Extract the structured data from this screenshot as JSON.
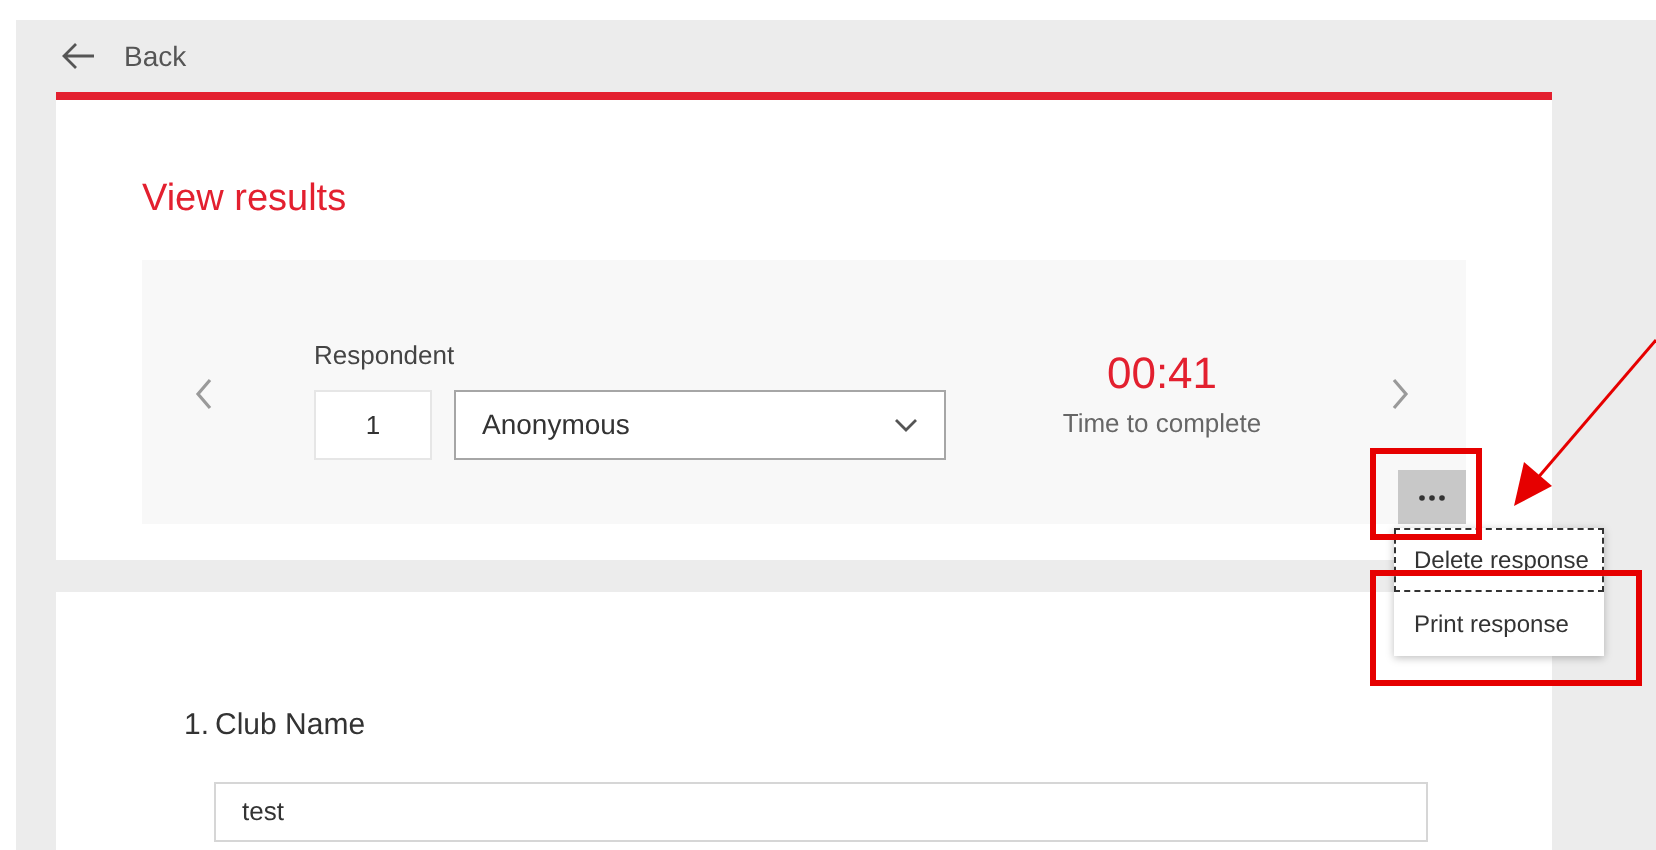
{
  "back": {
    "label": "Back"
  },
  "title": "View results",
  "respondent": {
    "label": "Respondent",
    "number": "1",
    "name": "Anonymous"
  },
  "timer": {
    "value": "00:41",
    "label": "Time to complete"
  },
  "menu": {
    "items": [
      {
        "label": "Delete response",
        "focused": true
      },
      {
        "label": "Print response",
        "focused": false
      }
    ]
  },
  "questions": [
    {
      "number": "1.",
      "title": "Club Name",
      "answer": "test"
    }
  ]
}
